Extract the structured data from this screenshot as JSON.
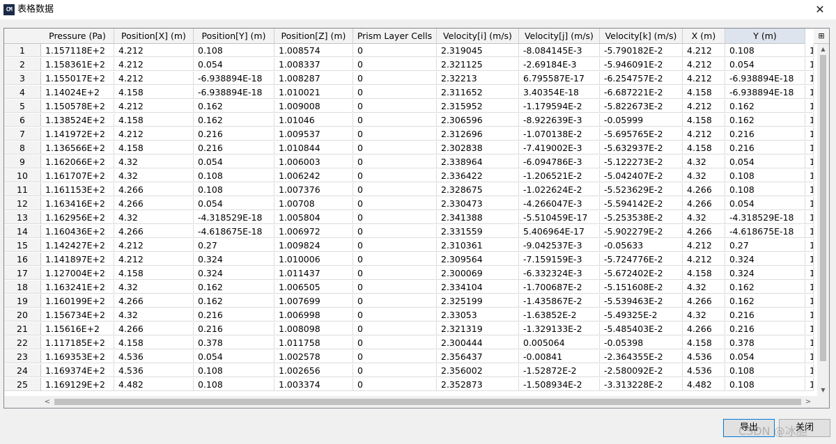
{
  "window": {
    "icon_text": "CM",
    "title": "表格数据",
    "close_glyph": "✕"
  },
  "table": {
    "columns": [
      "Pressure (Pa)",
      "Position[X] (m)",
      "Position[Y] (m)",
      "Position[Z] (m)",
      "Prism Layer Cells",
      "Velocity[i] (m/s)",
      "Velocity[j] (m/s)",
      "Velocity[k] (m/s)",
      "X (m)",
      "Y (m)"
    ],
    "corner_icon": "⊞",
    "rows": [
      [
        "1",
        "1.157118E+2",
        "4.212",
        "0.108",
        "1.008574",
        "0",
        "2.319045",
        "-8.084145E-3",
        "-5.790182E-2",
        "4.212",
        "0.108",
        "1"
      ],
      [
        "2",
        "1.158361E+2",
        "4.212",
        "0.054",
        "1.008337",
        "0",
        "2.321125",
        "-2.69184E-3",
        "-5.946091E-2",
        "4.212",
        "0.054",
        "1"
      ],
      [
        "3",
        "1.155017E+2",
        "4.212",
        "-6.938894E-18",
        "1.008287",
        "0",
        "2.32213",
        "6.795587E-17",
        "-6.254757E-2",
        "4.212",
        "-6.938894E-18",
        "1"
      ],
      [
        "4",
        "1.14024E+2",
        "4.158",
        "-6.938894E-18",
        "1.010021",
        "0",
        "2.311652",
        "3.40354E-18",
        "-6.687221E-2",
        "4.158",
        "-6.938894E-18",
        "1"
      ],
      [
        "5",
        "1.150578E+2",
        "4.212",
        "0.162",
        "1.009008",
        "0",
        "2.315952",
        "-1.179594E-2",
        "-5.822673E-2",
        "4.212",
        "0.162",
        "1"
      ],
      [
        "6",
        "1.138524E+2",
        "4.158",
        "0.162",
        "1.01046",
        "0",
        "2.306596",
        "-8.922639E-3",
        "-0.05999",
        "4.158",
        "0.162",
        "1"
      ],
      [
        "7",
        "1.141972E+2",
        "4.212",
        "0.216",
        "1.009537",
        "0",
        "2.312696",
        "-1.070138E-2",
        "-5.695765E-2",
        "4.212",
        "0.216",
        "1"
      ],
      [
        "8",
        "1.136566E+2",
        "4.158",
        "0.216",
        "1.010844",
        "0",
        "2.302838",
        "-7.419002E-3",
        "-5.632937E-2",
        "4.158",
        "0.216",
        "1"
      ],
      [
        "9",
        "1.162066E+2",
        "4.32",
        "0.054",
        "1.006003",
        "0",
        "2.338964",
        "-6.094786E-3",
        "-5.122273E-2",
        "4.32",
        "0.054",
        "1"
      ],
      [
        "10",
        "1.161707E+2",
        "4.32",
        "0.108",
        "1.006242",
        "0",
        "2.336422",
        "-1.206521E-2",
        "-5.042407E-2",
        "4.32",
        "0.108",
        "1"
      ],
      [
        "11",
        "1.161153E+2",
        "4.266",
        "0.108",
        "1.007376",
        "0",
        "2.328675",
        "-1.022624E-2",
        "-5.523629E-2",
        "4.266",
        "0.108",
        "1"
      ],
      [
        "12",
        "1.163416E+2",
        "4.266",
        "0.054",
        "1.00708",
        "0",
        "2.330473",
        "-4.266047E-3",
        "-5.594142E-2",
        "4.266",
        "0.054",
        "1"
      ],
      [
        "13",
        "1.162956E+2",
        "4.32",
        "-4.318529E-18",
        "1.005804",
        "0",
        "2.341388",
        "-5.510459E-17",
        "-5.253538E-2",
        "4.32",
        "-4.318529E-18",
        "1"
      ],
      [
        "14",
        "1.160436E+2",
        "4.266",
        "-4.618675E-18",
        "1.006972",
        "0",
        "2.331559",
        "5.406964E-17",
        "-5.902279E-2",
        "4.266",
        "-4.618675E-18",
        "1"
      ],
      [
        "15",
        "1.142427E+2",
        "4.212",
        "0.27",
        "1.009824",
        "0",
        "2.310361",
        "-9.042537E-3",
        "-0.05633",
        "4.212",
        "0.27",
        "1"
      ],
      [
        "16",
        "1.141897E+2",
        "4.212",
        "0.324",
        "1.010006",
        "0",
        "2.309564",
        "-7.159159E-3",
        "-5.724776E-2",
        "4.212",
        "0.324",
        "1"
      ],
      [
        "17",
        "1.127004E+2",
        "4.158",
        "0.324",
        "1.011437",
        "0",
        "2.300069",
        "-6.332324E-3",
        "-5.672402E-2",
        "4.158",
        "0.324",
        "1"
      ],
      [
        "18",
        "1.163241E+2",
        "4.32",
        "0.162",
        "1.006505",
        "0",
        "2.334104",
        "-1.700687E-2",
        "-5.151608E-2",
        "4.32",
        "0.162",
        "1"
      ],
      [
        "19",
        "1.160199E+2",
        "4.266",
        "0.162",
        "1.007699",
        "0",
        "2.325199",
        "-1.435867E-2",
        "-5.539463E-2",
        "4.266",
        "0.162",
        "1"
      ],
      [
        "20",
        "1.156734E+2",
        "4.32",
        "0.216",
        "1.006998",
        "0",
        "2.33053",
        "-1.63852E-2",
        "-5.49325E-2",
        "4.32",
        "0.216",
        "1"
      ],
      [
        "21",
        "1.15616E+2",
        "4.266",
        "0.216",
        "1.008098",
        "0",
        "2.321319",
        "-1.329133E-2",
        "-5.485403E-2",
        "4.266",
        "0.216",
        "1"
      ],
      [
        "22",
        "1.117185E+2",
        "4.158",
        "0.378",
        "1.011758",
        "0",
        "2.300444",
        "0.005064",
        "-0.05398",
        "4.158",
        "0.378",
        "1"
      ],
      [
        "23",
        "1.169353E+2",
        "4.536",
        "0.054",
        "1.002578",
        "0",
        "2.356437",
        "-0.00841",
        "-2.364355E-2",
        "4.536",
        "0.054",
        "1"
      ],
      [
        "24",
        "1.169374E+2",
        "4.536",
        "0.108",
        "1.002656",
        "0",
        "2.356002",
        "-1.52872E-2",
        "-2.580092E-2",
        "4.536",
        "0.108",
        "1"
      ],
      [
        "25",
        "1.169129E+2",
        "4.482",
        "0.108",
        "1.003374",
        "0",
        "2.352873",
        "-1.508934E-2",
        "-3.313228E-2",
        "4.482",
        "0.108",
        "1"
      ]
    ]
  },
  "scrollbars": {
    "up": "▲",
    "down": "▼",
    "left": "<",
    "right": ">"
  },
  "buttons": {
    "export_label": "导出",
    "close_label": "关闭"
  },
  "watermark": "CSDN @冰胆"
}
